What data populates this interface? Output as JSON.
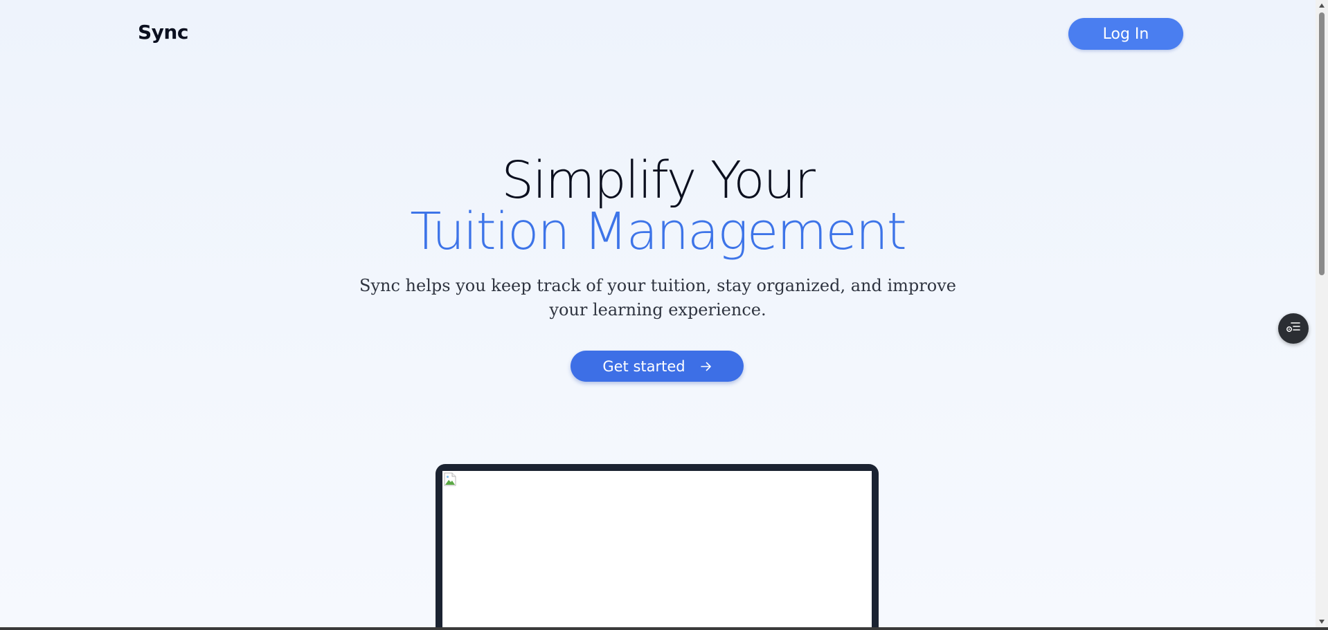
{
  "brand": {
    "name": "Sync"
  },
  "header": {
    "login_label": "Log In"
  },
  "hero": {
    "title_line1": "Simplify Your",
    "title_line2": "Tuition Management",
    "subtitle": "Sync helps you keep track of your tuition, stay organized, and improve your learning experience.",
    "cta_label": "Get started",
    "cta_icon": "arrow-right-icon"
  },
  "preview": {
    "image_state": "broken-image-icon"
  },
  "floating_action": {
    "icon": "list-settings-icon"
  },
  "colors": {
    "accent": "#3d74e8",
    "button": "#4a7ef0",
    "heading": "#0b0f1e",
    "laptop_frame": "#1b2331"
  }
}
